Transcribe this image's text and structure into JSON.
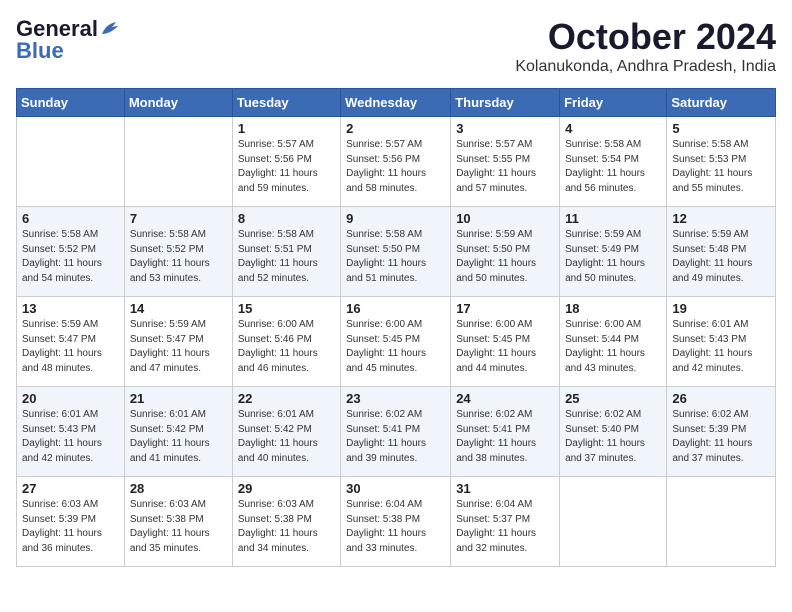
{
  "logo": {
    "line1a": "General",
    "line1b": "Blue",
    "line2": "Blue"
  },
  "title": "October 2024",
  "location": "Kolanukonda, Andhra Pradesh, India",
  "weekdays": [
    "Sunday",
    "Monday",
    "Tuesday",
    "Wednesday",
    "Thursday",
    "Friday",
    "Saturday"
  ],
  "weeks": [
    [
      {
        "day": null
      },
      {
        "day": null
      },
      {
        "day": "1",
        "sunrise": "Sunrise: 5:57 AM",
        "sunset": "Sunset: 5:56 PM",
        "daylight": "Daylight: 11 hours and 59 minutes."
      },
      {
        "day": "2",
        "sunrise": "Sunrise: 5:57 AM",
        "sunset": "Sunset: 5:56 PM",
        "daylight": "Daylight: 11 hours and 58 minutes."
      },
      {
        "day": "3",
        "sunrise": "Sunrise: 5:57 AM",
        "sunset": "Sunset: 5:55 PM",
        "daylight": "Daylight: 11 hours and 57 minutes."
      },
      {
        "day": "4",
        "sunrise": "Sunrise: 5:58 AM",
        "sunset": "Sunset: 5:54 PM",
        "daylight": "Daylight: 11 hours and 56 minutes."
      },
      {
        "day": "5",
        "sunrise": "Sunrise: 5:58 AM",
        "sunset": "Sunset: 5:53 PM",
        "daylight": "Daylight: 11 hours and 55 minutes."
      }
    ],
    [
      {
        "day": "6",
        "sunrise": "Sunrise: 5:58 AM",
        "sunset": "Sunset: 5:52 PM",
        "daylight": "Daylight: 11 hours and 54 minutes."
      },
      {
        "day": "7",
        "sunrise": "Sunrise: 5:58 AM",
        "sunset": "Sunset: 5:52 PM",
        "daylight": "Daylight: 11 hours and 53 minutes."
      },
      {
        "day": "8",
        "sunrise": "Sunrise: 5:58 AM",
        "sunset": "Sunset: 5:51 PM",
        "daylight": "Daylight: 11 hours and 52 minutes."
      },
      {
        "day": "9",
        "sunrise": "Sunrise: 5:58 AM",
        "sunset": "Sunset: 5:50 PM",
        "daylight": "Daylight: 11 hours and 51 minutes."
      },
      {
        "day": "10",
        "sunrise": "Sunrise: 5:59 AM",
        "sunset": "Sunset: 5:50 PM",
        "daylight": "Daylight: 11 hours and 50 minutes."
      },
      {
        "day": "11",
        "sunrise": "Sunrise: 5:59 AM",
        "sunset": "Sunset: 5:49 PM",
        "daylight": "Daylight: 11 hours and 50 minutes."
      },
      {
        "day": "12",
        "sunrise": "Sunrise: 5:59 AM",
        "sunset": "Sunset: 5:48 PM",
        "daylight": "Daylight: 11 hours and 49 minutes."
      }
    ],
    [
      {
        "day": "13",
        "sunrise": "Sunrise: 5:59 AM",
        "sunset": "Sunset: 5:47 PM",
        "daylight": "Daylight: 11 hours and 48 minutes."
      },
      {
        "day": "14",
        "sunrise": "Sunrise: 5:59 AM",
        "sunset": "Sunset: 5:47 PM",
        "daylight": "Daylight: 11 hours and 47 minutes."
      },
      {
        "day": "15",
        "sunrise": "Sunrise: 6:00 AM",
        "sunset": "Sunset: 5:46 PM",
        "daylight": "Daylight: 11 hours and 46 minutes."
      },
      {
        "day": "16",
        "sunrise": "Sunrise: 6:00 AM",
        "sunset": "Sunset: 5:45 PM",
        "daylight": "Daylight: 11 hours and 45 minutes."
      },
      {
        "day": "17",
        "sunrise": "Sunrise: 6:00 AM",
        "sunset": "Sunset: 5:45 PM",
        "daylight": "Daylight: 11 hours and 44 minutes."
      },
      {
        "day": "18",
        "sunrise": "Sunrise: 6:00 AM",
        "sunset": "Sunset: 5:44 PM",
        "daylight": "Daylight: 11 hours and 43 minutes."
      },
      {
        "day": "19",
        "sunrise": "Sunrise: 6:01 AM",
        "sunset": "Sunset: 5:43 PM",
        "daylight": "Daylight: 11 hours and 42 minutes."
      }
    ],
    [
      {
        "day": "20",
        "sunrise": "Sunrise: 6:01 AM",
        "sunset": "Sunset: 5:43 PM",
        "daylight": "Daylight: 11 hours and 42 minutes."
      },
      {
        "day": "21",
        "sunrise": "Sunrise: 6:01 AM",
        "sunset": "Sunset: 5:42 PM",
        "daylight": "Daylight: 11 hours and 41 minutes."
      },
      {
        "day": "22",
        "sunrise": "Sunrise: 6:01 AM",
        "sunset": "Sunset: 5:42 PM",
        "daylight": "Daylight: 11 hours and 40 minutes."
      },
      {
        "day": "23",
        "sunrise": "Sunrise: 6:02 AM",
        "sunset": "Sunset: 5:41 PM",
        "daylight": "Daylight: 11 hours and 39 minutes."
      },
      {
        "day": "24",
        "sunrise": "Sunrise: 6:02 AM",
        "sunset": "Sunset: 5:41 PM",
        "daylight": "Daylight: 11 hours and 38 minutes."
      },
      {
        "day": "25",
        "sunrise": "Sunrise: 6:02 AM",
        "sunset": "Sunset: 5:40 PM",
        "daylight": "Daylight: 11 hours and 37 minutes."
      },
      {
        "day": "26",
        "sunrise": "Sunrise: 6:02 AM",
        "sunset": "Sunset: 5:39 PM",
        "daylight": "Daylight: 11 hours and 37 minutes."
      }
    ],
    [
      {
        "day": "27",
        "sunrise": "Sunrise: 6:03 AM",
        "sunset": "Sunset: 5:39 PM",
        "daylight": "Daylight: 11 hours and 36 minutes."
      },
      {
        "day": "28",
        "sunrise": "Sunrise: 6:03 AM",
        "sunset": "Sunset: 5:38 PM",
        "daylight": "Daylight: 11 hours and 35 minutes."
      },
      {
        "day": "29",
        "sunrise": "Sunrise: 6:03 AM",
        "sunset": "Sunset: 5:38 PM",
        "daylight": "Daylight: 11 hours and 34 minutes."
      },
      {
        "day": "30",
        "sunrise": "Sunrise: 6:04 AM",
        "sunset": "Sunset: 5:38 PM",
        "daylight": "Daylight: 11 hours and 33 minutes."
      },
      {
        "day": "31",
        "sunrise": "Sunrise: 6:04 AM",
        "sunset": "Sunset: 5:37 PM",
        "daylight": "Daylight: 11 hours and 32 minutes."
      },
      {
        "day": null
      },
      {
        "day": null
      }
    ]
  ]
}
